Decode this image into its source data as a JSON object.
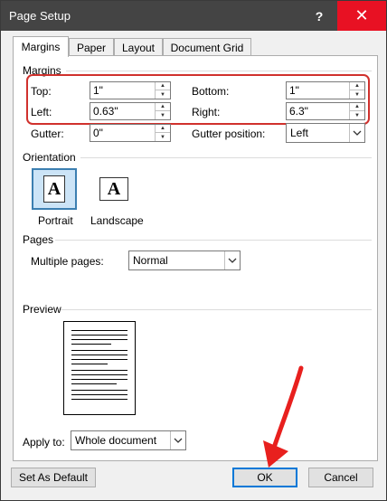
{
  "window": {
    "title": "Page Setup",
    "help_label": "?",
    "close_label": "✕"
  },
  "tabs": [
    {
      "label": "Margins",
      "active": true
    },
    {
      "label": "Paper",
      "active": false
    },
    {
      "label": "Layout",
      "active": false
    },
    {
      "label": "Document Grid",
      "active": false
    }
  ],
  "margins": {
    "section_label": "Margins",
    "top": {
      "label": "Top:",
      "value": "1\""
    },
    "bottom": {
      "label": "Bottom:",
      "value": "1\""
    },
    "left": {
      "label": "Left:",
      "value": "0.63\""
    },
    "right": {
      "label": "Right:",
      "value": "6.3\""
    },
    "gutter": {
      "label": "Gutter:",
      "value": "0\""
    },
    "gutter_position": {
      "label": "Gutter position:",
      "value": "Left"
    }
  },
  "orientation": {
    "section_label": "Orientation",
    "portrait_label": "Portrait",
    "landscape_label": "Landscape",
    "icon_letter": "A",
    "selected": "portrait"
  },
  "pages": {
    "section_label": "Pages",
    "multiple_pages_label": "Multiple pages:",
    "multiple_pages_value": "Normal"
  },
  "preview": {
    "section_label": "Preview"
  },
  "apply_to": {
    "label": "Apply to:",
    "value": "Whole document"
  },
  "buttons": {
    "set_as_default": "Set As Default",
    "ok": "OK",
    "cancel": "Cancel"
  },
  "colors": {
    "titlebar": "#444444",
    "close": "#e81123",
    "highlight": "#d0312d",
    "arrow": "#e8201e",
    "selected": "#cce4f7"
  }
}
